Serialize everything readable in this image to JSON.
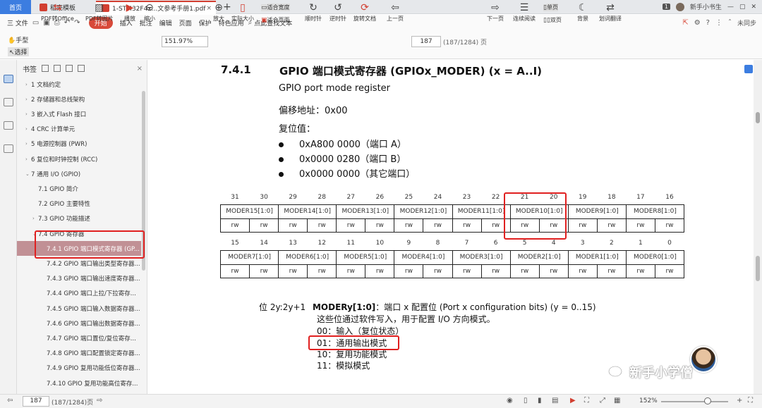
{
  "tabs": {
    "home": "首页",
    "wps": "稻壳模板",
    "active": "1-STM32F4x...文参考手册1.pdf",
    "user_badge": "1",
    "user_name": "新手小书生"
  },
  "menu": {
    "file": "三 文件",
    "start": "开始",
    "items": [
      "插入",
      "批注",
      "编辑",
      "页面",
      "保护",
      "特色应用"
    ],
    "search": "点此查找文本",
    "sync": "未同步"
  },
  "toolbar": {
    "hand": "手型",
    "select": "选择",
    "pdf_office": "PDF转Office",
    "pdf_image": "PDF转图片",
    "play": "播放",
    "zoom_out": "缩小",
    "zoom_value": "151.97%",
    "zoom_in": "放大",
    "actual_size": "实际大小",
    "fit_width": "适合宽度",
    "fit_page": "适合页面",
    "rotate_cw": "顺时针",
    "rotate_ccw": "逆时针",
    "rotate_doc": "旋转文档",
    "prev_page": "上一页",
    "page_value": "187",
    "page_total": "(187/1284) 页",
    "next_page": "下一页",
    "continuous": "连续阅读",
    "single": "单页",
    "double": "双页",
    "background": "背景",
    "translate": "划词翻译"
  },
  "sidebar": {
    "title": "书签",
    "items": [
      {
        "caret": "›",
        "label": "1 文档约定"
      },
      {
        "caret": "›",
        "label": "2 存储器和总线架构"
      },
      {
        "caret": "›",
        "label": "3 嵌入式 Flash 接口"
      },
      {
        "caret": "›",
        "label": "4 CRC 计算单元"
      },
      {
        "caret": "›",
        "label": "5 电源控制器 (PWR)"
      },
      {
        "caret": "›",
        "label": "6 复位和时钟控制 (RCC)"
      },
      {
        "caret": "⌄",
        "label": "7 通用 I/O (GPIO)"
      },
      {
        "caret": "",
        "label": "7.1 GPIO 简介"
      },
      {
        "caret": "",
        "label": "7.2 GPIO 主要特性"
      },
      {
        "caret": "›",
        "label": "7.3 GPIO 功能描述"
      },
      {
        "caret": "⌄",
        "label": "7.4 GPIO 寄存器"
      },
      {
        "caret": "",
        "label": "7.4.1 GPIO 端口模式寄存器 (GP..."
      },
      {
        "caret": "",
        "label": "7.4.2 GPIO 端口输出类型寄存器..."
      },
      {
        "caret": "",
        "label": "7.4.3 GPIO 端口输出速度寄存器..."
      },
      {
        "caret": "",
        "label": "7.4.4 GPIO 端口上拉/下拉寄存..."
      },
      {
        "caret": "",
        "label": "7.4.5 GPIO 端口输入数据寄存器..."
      },
      {
        "caret": "",
        "label": "7.4.6 GPIO 端口输出数据寄存器..."
      },
      {
        "caret": "",
        "label": "7.4.7 GPIO 端口置位/复位寄存..."
      },
      {
        "caret": "",
        "label": "7.4.8 GPIO 端口配置锁定寄存器..."
      },
      {
        "caret": "",
        "label": "7.4.9 GPIO 复用功能低位寄存器..."
      },
      {
        "caret": "",
        "label": "7.4.10 GPIO 复用功能高位寄存..."
      }
    ]
  },
  "doc": {
    "section_num": "7.4.1",
    "section_title": "GPIO 端口模式寄存器 (GPIOx_MODER) (x = A..I)",
    "subtitle": "GPIO port mode register",
    "offset": "偏移地址：0x00",
    "reset_label": "复位值：",
    "reset_values": [
      "0xA800 0000（端口 A）",
      "0x0000 0280（端口 B）",
      "0x0000 0000（其它端口）"
    ],
    "bits_high": [
      "31",
      "30",
      "29",
      "28",
      "27",
      "26",
      "25",
      "24",
      "23",
      "22",
      "21",
      "20",
      "19",
      "18",
      "17",
      "16"
    ],
    "fields_high": [
      "MODER15[1:0]",
      "MODER14[1:0]",
      "MODER13[1:0]",
      "MODER12[1:0]",
      "MODER11[1:0]",
      "MODER10[1:0]",
      "MODER9[1:0]",
      "MODER8[1:0]"
    ],
    "bits_low": [
      "15",
      "14",
      "13",
      "12",
      "11",
      "10",
      "9",
      "8",
      "7",
      "6",
      "5",
      "4",
      "3",
      "2",
      "1",
      "0"
    ],
    "fields_low": [
      "MODER7[1:0]",
      "MODER6[1:0]",
      "MODER5[1:0]",
      "MODER4[1:0]",
      "MODER3[1:0]",
      "MODER2[1:0]",
      "MODER1[1:0]",
      "MODER0[1:0]"
    ],
    "rw": "rw",
    "desc_bits": "位 2y:2y+1",
    "desc_field": "MODERy[1:0]",
    "desc_rest": "：端口 x 配置位 (Port x configuration bits) (y = 0..15)",
    "desc_line2": "这些位通过软件写入，用于配置 I/O 方向模式。",
    "modes": [
      "00：输入（复位状态）",
      "01：通用输出模式",
      "10：复用功能模式",
      "11：模拟模式"
    ]
  },
  "watermark": "新手小学僧",
  "status": {
    "page": "187",
    "total": "(187/1284)页",
    "zoom": "152%"
  }
}
